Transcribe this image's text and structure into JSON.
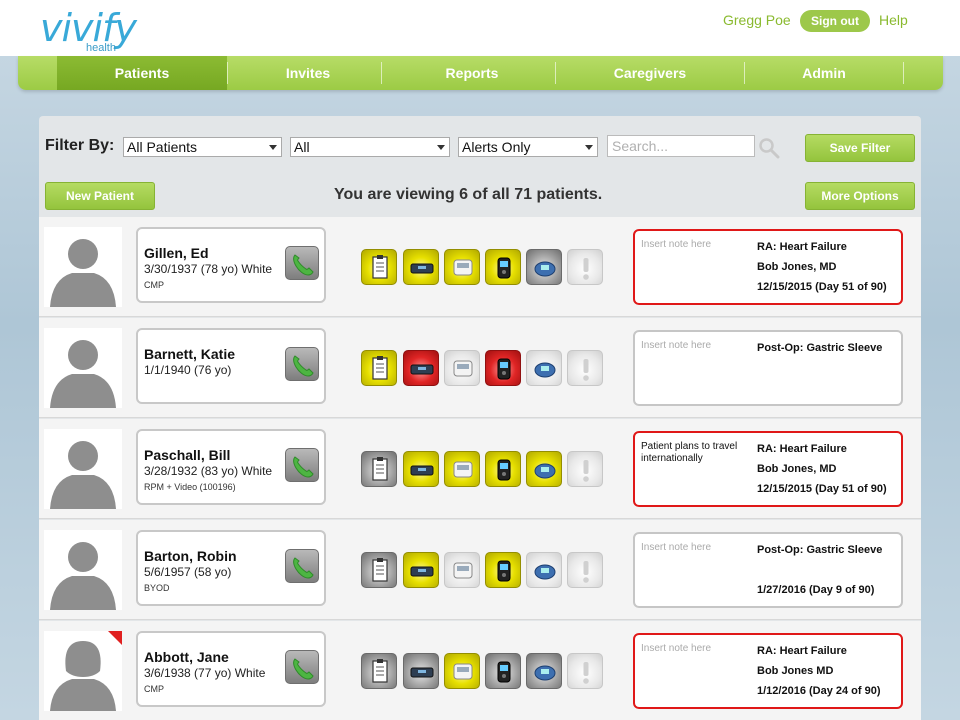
{
  "header": {
    "logo_text": "vivify",
    "logo_sub": "health",
    "user_name": "Gregg Poe",
    "signout_label": "Sign out",
    "help_label": "Help"
  },
  "nav": {
    "tabs": [
      {
        "label": "Patients",
        "active": true
      },
      {
        "label": "Invites",
        "active": false
      },
      {
        "label": "Reports",
        "active": false
      },
      {
        "label": "Caregivers",
        "active": false
      },
      {
        "label": "Admin",
        "active": false
      }
    ]
  },
  "filter": {
    "label": "Filter By:",
    "patients_select": "All Patients",
    "scope_select": "All",
    "alerts_select": "Alerts Only",
    "search_placeholder": "Search...",
    "save_filter_label": "Save Filter",
    "new_patient_label": "New Patient",
    "more_options_label": "More Options",
    "viewing_text": "You are viewing 6 of all 71 patients."
  },
  "colors": {
    "accent_green": "#9dc84a",
    "alert_red": "#e01818",
    "logo_blue": "#39a9d8"
  },
  "patients": [
    {
      "name": "Gillen, Ed",
      "dob": "3/30/1937 (78 yo) White",
      "tag": "CMP",
      "devices": [
        "y",
        "y",
        "y",
        "y",
        "g",
        "l"
      ],
      "note": "Insert note here",
      "note_placeholder": true,
      "program": "RA: Heart Failure",
      "doctor": "Bob Jones, MD",
      "date": "12/15/2015 (Day 51 of 90)",
      "alert": true,
      "flag": false
    },
    {
      "name": "Barnett, Katie",
      "dob": "1/1/1940 (76 yo)",
      "tag": "",
      "devices": [
        "y",
        "r",
        "l",
        "r",
        "l",
        "l"
      ],
      "note": "Insert note here",
      "note_placeholder": true,
      "program": "Post-Op: Gastric Sleeve",
      "doctor": "",
      "date": "",
      "alert": false,
      "flag": false
    },
    {
      "name": "Paschall, Bill",
      "dob": "3/28/1932 (83 yo) White",
      "tag": "RPM + Video (100196)",
      "devices": [
        "g",
        "y",
        "y",
        "y",
        "y",
        "l"
      ],
      "note": "Patient plans to travel internationally",
      "note_placeholder": false,
      "program": "RA: Heart Failure",
      "doctor": "Bob Jones, MD",
      "date": "12/15/2015 (Day 51 of 90)",
      "alert": true,
      "flag": false
    },
    {
      "name": "Barton, Robin",
      "dob": "5/6/1957 (58 yo)",
      "tag": "BYOD",
      "devices": [
        "g",
        "y",
        "l",
        "y",
        "l",
        "l"
      ],
      "note": "Insert note here",
      "note_placeholder": true,
      "program": "Post-Op: Gastric Sleeve",
      "doctor": "",
      "date": "1/27/2016 (Day 9 of 90)",
      "alert": false,
      "flag": false
    },
    {
      "name": "Abbott, Jane",
      "dob": "3/6/1938 (77 yo) White",
      "tag": "CMP",
      "devices": [
        "g",
        "g",
        "y",
        "g",
        "g",
        "l"
      ],
      "note": "Insert note here",
      "note_placeholder": true,
      "program": "RA: Heart Failure",
      "doctor": "Bob Jones MD",
      "date": "1/12/2016 (Day 24 of 90)",
      "alert": true,
      "flag": true
    }
  ]
}
